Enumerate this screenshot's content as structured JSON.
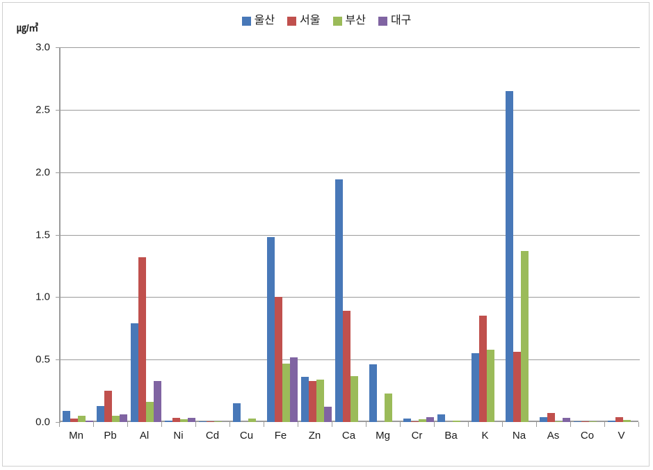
{
  "chart_data": {
    "type": "bar",
    "title": "",
    "subtitle": "",
    "xlabel": "",
    "ylabel": "㎍/㎥",
    "ylim": [
      0,
      3.0
    ],
    "ytick_step": 0.5,
    "grid": true,
    "legend_position": "top-center",
    "categories": [
      "Mn",
      "Pb",
      "Al",
      "Ni",
      "Cd",
      "Cu",
      "Fe",
      "Zn",
      "Ca",
      "Mg",
      "Cr",
      "Ba",
      "K",
      "Na",
      "As",
      "Co",
      "V"
    ],
    "ytick_labels": [
      "3.0",
      "2.5",
      "2.0",
      "1.5",
      "1.0",
      "0.5",
      "0.0"
    ],
    "ytick_values": [
      3.0,
      2.5,
      2.0,
      1.5,
      1.0,
      0.5,
      0.0
    ],
    "series": [
      {
        "name": "울산",
        "color": "#4878b8",
        "values": [
          0.09,
          0.13,
          0.79,
          0.01,
          0.005,
          0.15,
          1.48,
          0.36,
          1.94,
          0.46,
          0.03,
          0.06,
          0.55,
          2.65,
          0.04,
          0.005,
          0.01
        ]
      },
      {
        "name": "서울",
        "color": "#c0504d",
        "values": [
          0.03,
          0.25,
          1.32,
          0.035,
          0.005,
          0.0,
          1.0,
          0.33,
          0.89,
          0.0,
          0.005,
          0.0,
          0.85,
          0.56,
          0.07,
          0.005,
          0.04
        ]
      },
      {
        "name": "부산",
        "color": "#9bbb59",
        "values": [
          0.05,
          0.05,
          0.16,
          0.02,
          0.005,
          0.03,
          0.47,
          0.34,
          0.37,
          0.23,
          0.02,
          0.01,
          0.58,
          1.37,
          0.005,
          0.005,
          0.015
        ]
      },
      {
        "name": "대구",
        "color": "#8064a2",
        "values": [
          0.01,
          0.06,
          0.33,
          0.035,
          0.0,
          0.0,
          0.52,
          0.12,
          0.0,
          0.0,
          0.04,
          0.0,
          0.0,
          0.0,
          0.035,
          0.0,
          0.0
        ]
      }
    ]
  },
  "colors": {
    "ulsan": "#4878b8",
    "seoul": "#c0504d",
    "busan": "#9bbb59",
    "daegu": "#8064a2",
    "axis": "#9a9a9a",
    "frame": "#cfcfcf",
    "text": "#1a1a1a",
    "background": "#ffffff"
  }
}
